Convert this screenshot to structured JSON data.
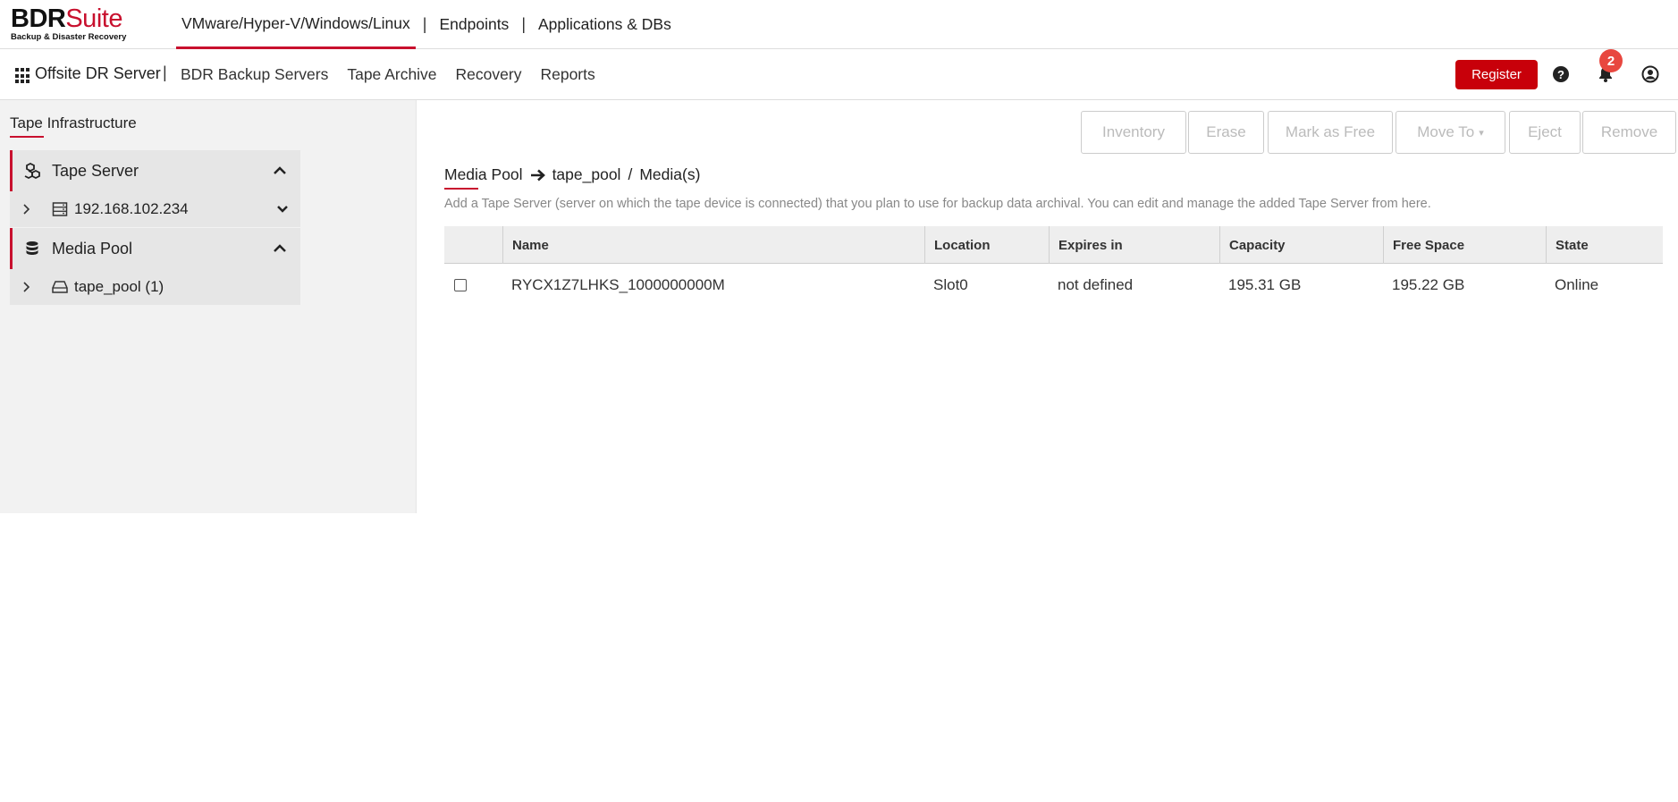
{
  "header": {
    "logo": {
      "brand_main": "BDR",
      "brand_suite": "Suite",
      "tagline": "Backup & Disaster Recovery"
    },
    "product_nav": [
      {
        "label": "VMware/Hyper-V/Windows/Linux",
        "active": true
      },
      {
        "label": "Endpoints",
        "active": false
      },
      {
        "label": "Applications & DBs",
        "active": false
      }
    ],
    "separator": "|"
  },
  "navbar": {
    "app_title": "Offsite DR Server",
    "separator": "|",
    "links": [
      "BDR Backup Servers",
      "Tape Archive",
      "Recovery",
      "Reports"
    ],
    "register_label": "Register",
    "help_icon": "question-circle-icon",
    "notification_icon": "bell-icon",
    "notification_count": "2",
    "user_icon": "user-circle-icon"
  },
  "sidebar": {
    "title": "Tape Infrastructure",
    "sections": [
      {
        "label": "Tape Server",
        "icon": "cubes-icon",
        "expanded": true,
        "items": [
          {
            "label": "192.168.102.234",
            "icon": "server-icon"
          }
        ]
      },
      {
        "label": "Media Pool",
        "icon": "database-icon",
        "expanded": true,
        "items": [
          {
            "label": "tape_pool (1)",
            "icon": "hdd-icon"
          }
        ]
      }
    ]
  },
  "toolbar": {
    "inventory": "Inventory",
    "erase": "Erase",
    "mark_as_free": "Mark as Free",
    "move_to": "Move To",
    "eject": "Eject",
    "remove": "Remove"
  },
  "breadcrumb": {
    "root": "Media Pool",
    "pool": "tape_pool",
    "slash": "/",
    "current": "Media(s)"
  },
  "description": "Add a Tape Server (server on which the tape device is connected) that you plan to use for backup data archival. You can edit and manage the added Tape Server from here.",
  "table": {
    "columns": [
      "Name",
      "Location",
      "Expires in",
      "Capacity",
      "Free Space",
      "State"
    ],
    "rows": [
      {
        "name": "RYCX1Z7LHKS_1000000000M",
        "location": "Slot0",
        "expires_in": "not defined",
        "capacity": "195.31 GB",
        "free_space": "195.22 GB",
        "state": "Online"
      }
    ]
  },
  "colors": {
    "accent": "#c8102e",
    "register": "#c8000a",
    "badge": "#e8473f"
  }
}
